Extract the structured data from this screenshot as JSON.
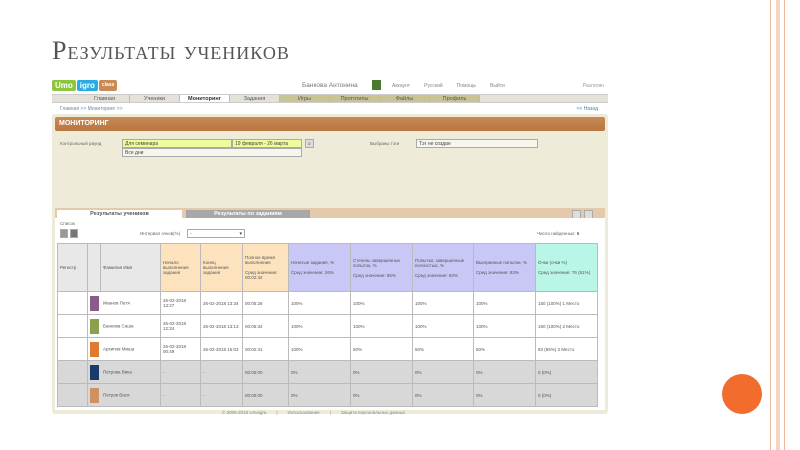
{
  "slide_title": "Результаты учеников",
  "logo": [
    "Umo",
    "igro",
    "class"
  ],
  "user_name": "Банкова Антонина",
  "top_links": [
    "Аккаунт",
    "Русский",
    "Помощь",
    "Выйти"
  ],
  "exit_label": "Разлогин",
  "nav": [
    "Главная",
    "Ученики",
    "Мониторинг",
    "Задания",
    "Игры",
    "Прототипы",
    "Файлы",
    "Профиль"
  ],
  "breadcrumb": "Главная >> Мониторинг >>",
  "back": "<< Назад",
  "panel_title": "МОНИТОРИНГ",
  "control_round_label": "Контрольный раунд",
  "control_round_value": "Для семинара",
  "date_range": "19 февраля - 26 марта",
  "all_days": "Все дни",
  "tags_label": "Выбраны тэги",
  "tags_value": "Тэг не создан",
  "tabs": [
    "Результаты учеников",
    "Результаты по заданиям"
  ],
  "list_label": "Список",
  "interval_label": "Интервал очков(%)",
  "interval_value": "-",
  "found_label": "Число найденных:",
  "found_count": "5",
  "headers": [
    "Регистр",
    "",
    "Фамилия Имя",
    "Начало выполнения задания",
    "Конец выполнения задания",
    "Полное время выполнения\n\nСред значение: 00:02:42",
    "Начатые задания, %\n\nСред значение: 26%",
    "Степень завершенных попыток, %\n\nСред значение: 85%",
    "Попытки, завершенные полностью, %\n\nСред значение: 83%",
    "Выигранные попытки, %\n\nСред значение: 83%",
    "Очки (очки %)\n\nСред значение: 76 (51%)"
  ],
  "rows": [
    {
      "name": "Иванов Петя",
      "start": "26-02-2018 13:27",
      "end": "26-02-2018 13:34",
      "time": "00:05:28",
      "c1": "100%",
      "c2": "100%",
      "c3": "100%",
      "c4": "100%",
      "score": "150 (100%) 1 Место",
      "avatar": "#8a5a8a"
    },
    {
      "name": "Банкова Саша",
      "start": "26-02-2018 12:24",
      "end": "26-02-2018 13:13",
      "time": "00:05:34",
      "c1": "100%",
      "c2": "100%",
      "c3": "100%",
      "c4": "100%",
      "score": "150 (100%) 2 Место",
      "avatar": "#8aa04a"
    },
    {
      "name": "Архипов Миша",
      "start": "26-02-2018 00:49",
      "end": "26-02-2018 15:03",
      "time": "00:02:31",
      "c1": "100%",
      "c2": "50%",
      "c3": "50%",
      "c4": "50%",
      "score": "83 (55%) 3 Место",
      "avatar": "#e07a30"
    },
    {
      "name": "Петрова Вика",
      "start": "-",
      "end": "-",
      "time": "00:00:00",
      "c1": "0%",
      "c2": "0%",
      "c3": "0%",
      "c4": "0%",
      "score": "0 (0%)",
      "avatar": "#1a3a6a"
    },
    {
      "name": "Петров Вася",
      "start": "-",
      "end": "-",
      "time": "00:00:00",
      "c1": "0%",
      "c2": "0%",
      "c3": "0%",
      "c4": "0%",
      "score": "0 (0%)",
      "avatar": "#d09060"
    }
  ],
  "footer": [
    "© 2006-2018 Umaigra",
    "Использование",
    "Защита персональных данных"
  ]
}
